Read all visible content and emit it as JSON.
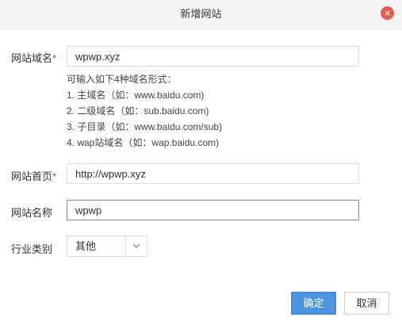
{
  "dialog": {
    "title": "新增网站",
    "close_icon": "close-icon",
    "close_glyph": "×"
  },
  "form": {
    "domain": {
      "label": "网站域名",
      "required_mark": "*",
      "value": "wpwp.xyz"
    },
    "hints": [
      "可输入如下4种域名形式：",
      "1. 主域名（如：www.baidu.com)",
      "2. 二级域名（如：sub.baidu.com)",
      "3. 子目录（如：www.baidu.com/sub)",
      "4. wap站域名（如：wap.baidu.com)"
    ],
    "homepage": {
      "label": "网站首页",
      "required_mark": "*",
      "value": "http://wpwp.xyz"
    },
    "site_name": {
      "label": "网站名称",
      "value": "wpwp"
    },
    "industry": {
      "label": "行业类别",
      "selected": "其他"
    }
  },
  "buttons": {
    "confirm": "确定",
    "cancel": "取消"
  },
  "colors": {
    "primary": "#4d94e0",
    "close": "#e35a4e",
    "required": "#e0392c"
  }
}
